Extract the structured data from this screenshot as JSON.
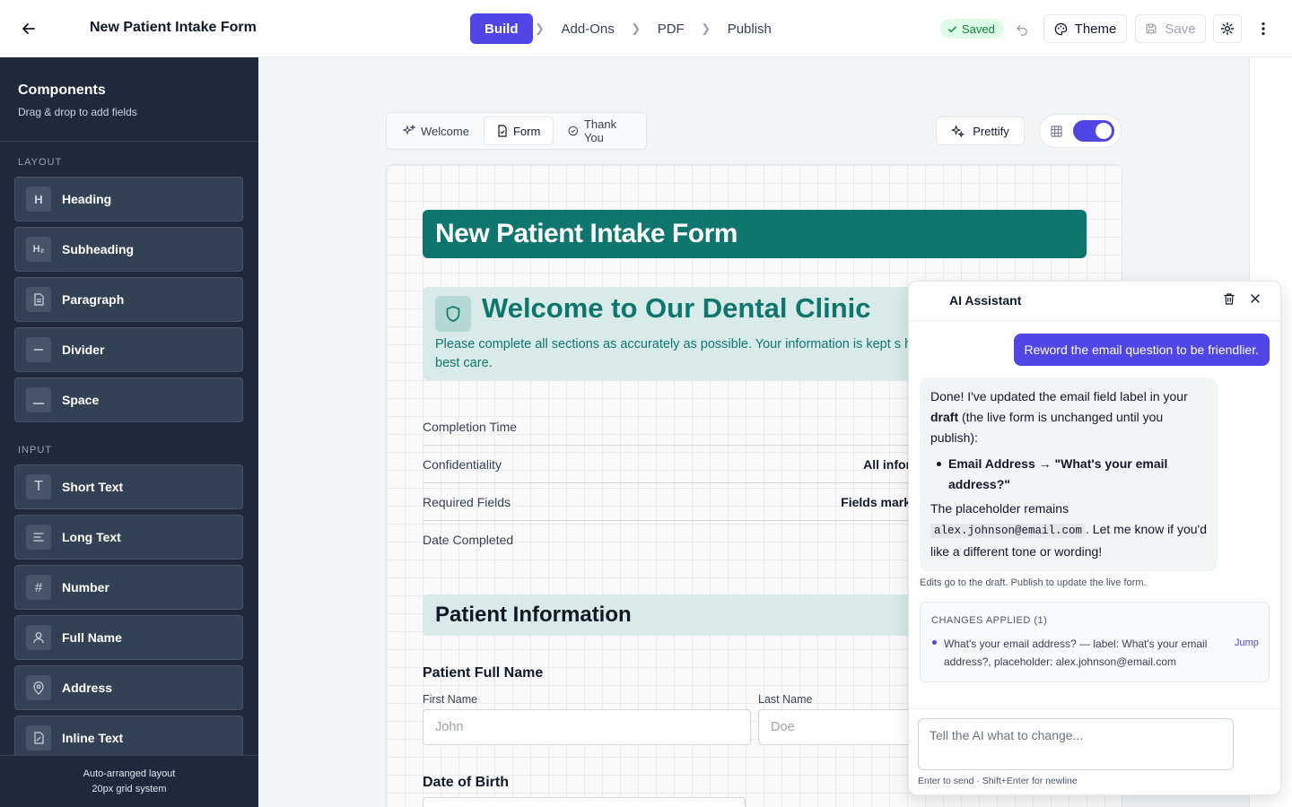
{
  "header": {
    "form_title": "New Patient Intake Form",
    "steps": [
      "Build",
      "Add-Ons",
      "PDF",
      "Publish"
    ],
    "active_step": "Build",
    "saved_label": "Saved",
    "theme_label": "Theme",
    "save_label": "Save",
    "accent_color": "#4f46e5"
  },
  "sidebar": {
    "title": "Components",
    "subtitle": "Drag & drop to add fields",
    "sections": [
      {
        "label": "LAYOUT",
        "items": [
          {
            "label": "Heading",
            "icon": "H"
          },
          {
            "label": "Subheading",
            "icon": "H₂"
          },
          {
            "label": "Paragraph",
            "icon": "paragraph-icon"
          },
          {
            "label": "Divider",
            "icon": "divider-icon"
          },
          {
            "label": "Space",
            "icon": "space-icon"
          }
        ]
      },
      {
        "label": "INPUT",
        "items": [
          {
            "label": "Short Text",
            "icon": "T"
          },
          {
            "label": "Long Text",
            "icon": "long-text-icon"
          },
          {
            "label": "Number",
            "icon": "#"
          },
          {
            "label": "Full Name",
            "icon": "user-icon"
          },
          {
            "label": "Address",
            "icon": "location-icon"
          },
          {
            "label": "Inline Text",
            "icon": "inline-text-icon"
          }
        ]
      }
    ],
    "footer_line1": "Auto-arranged layout",
    "footer_line2": "20px grid system"
  },
  "canvas": {
    "tabs": [
      "Welcome",
      "Form",
      "Thank You"
    ],
    "active_tab": "Form",
    "prettify_label": "Prettify",
    "grid_toggle_on": true
  },
  "form": {
    "banner_title": "New Patient Intake Form",
    "welcome_title": "Welcome to Our Dental Clinic",
    "welcome_text": "Please complete all sections as accurately as possible. Your information is kept s helps us provide you with the best care.",
    "info_rows": [
      {
        "label": "Completion Time",
        "value": ""
      },
      {
        "label": "Confidentiality",
        "value": "All infor"
      },
      {
        "label": "Required Fields",
        "value": "Fields mark"
      },
      {
        "label": "Date Completed",
        "value": ""
      }
    ],
    "section_title": "Patient Information",
    "patient_full_name_label": "Patient Full Name",
    "first_name_label": "First Name",
    "first_name_placeholder": "John",
    "last_name_label": "Last Name",
    "last_name_placeholder": "Doe",
    "dob_label": "Date of Birth",
    "brand_color": "#0f766e"
  },
  "ai": {
    "title": "AI Assistant",
    "user_message": "Reword the email question to be friendlier.",
    "bot_intro_1": "Done! I've updated the email field label in your ",
    "bot_intro_bold": "draft",
    "bot_intro_2": " (the live form is unchanged until you publish):",
    "bot_bullet": "Email Address → \"What's your email address?\"",
    "bot_outro_1": "The placeholder remains ",
    "bot_code": "alex.johnson@email.com",
    "bot_outro_2": ". Let me know if you'd like a different tone or wording!",
    "note": "Edits go to the draft. Publish to update the live form.",
    "changes_title": "CHANGES APPLIED (1)",
    "change_text": "What's your email address? — label: What's your email address?, placeholder: alex.johnson@email.com",
    "jump_label": "Jump",
    "input_placeholder": "Tell the AI what to change...",
    "hint": "Enter to send · Shift+Enter for newline"
  }
}
